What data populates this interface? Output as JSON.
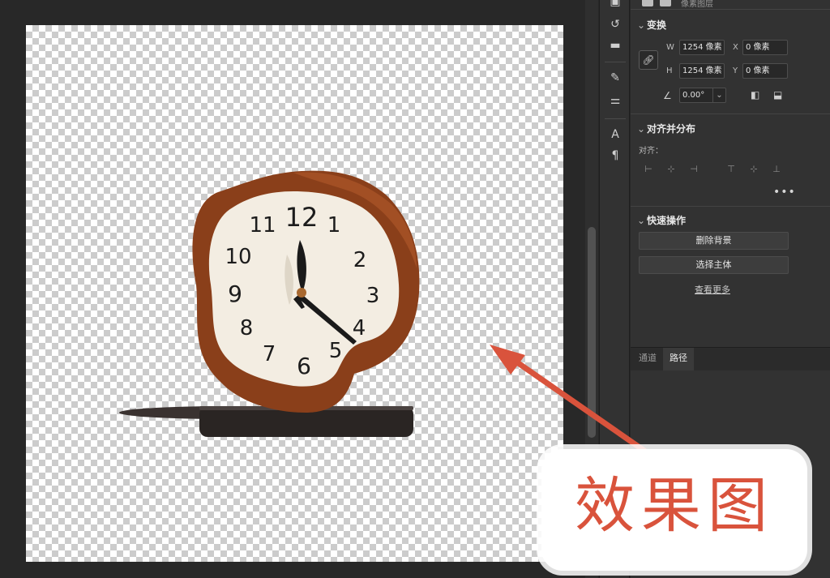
{
  "canvas": {
    "clock_numerals": [
      "12",
      "1",
      "2",
      "3",
      "4",
      "5",
      "6",
      "7",
      "8",
      "9",
      "10",
      "11"
    ]
  },
  "layer": {
    "name": "像素图层"
  },
  "transform": {
    "title": "变换",
    "w_label": "W",
    "w_value": "1254 像素",
    "h_label": "H",
    "h_value": "1254 像素",
    "x_label": "X",
    "x_value": "0 像素",
    "y_label": "Y",
    "y_value": "0 像素",
    "angle_value": "0.00°"
  },
  "align": {
    "title": "对齐并分布",
    "label": "对齐：",
    "more": "•••"
  },
  "quick_actions": {
    "title": "快速操作",
    "remove_bg": "删除背景",
    "select_subject": "选择主体",
    "see_more": "查看更多"
  },
  "tabs": [
    {
      "label": "通道",
      "active": false
    },
    {
      "label": "路径",
      "active": true
    }
  ],
  "annotation": {
    "text": "效果图",
    "color": "#d9533c"
  },
  "colors": {
    "panel_bg": "#323232",
    "workspace_bg": "#282828",
    "clock_rim": "#8a3f1a",
    "clock_face": "#f3ede2",
    "clock_base": "#2a2523",
    "arrow": "#d9533c"
  },
  "icons": {
    "tools": [
      "layers-icon",
      "history-icon",
      "comment-icon",
      "brush-presets-icon",
      "adjust-icon",
      "character-icon",
      "paragraph-icon"
    ]
  }
}
